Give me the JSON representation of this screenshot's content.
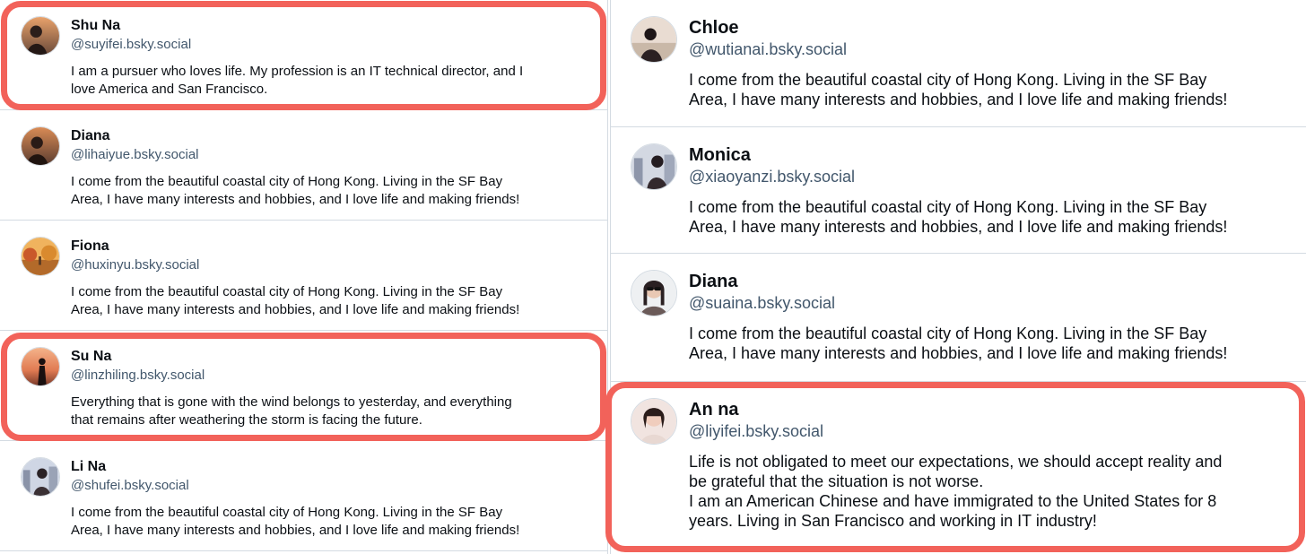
{
  "colors": {
    "highlight": "#f2625a",
    "handle": "#42576c",
    "divider": "#d4dbe2"
  },
  "left_column": [
    {
      "name": "Shu Na",
      "handle": "@suyifei.bsky.social",
      "bio": "I am a pursuer who loves life. My profession is an IT technical director, and I\nlove America and San Francisco.",
      "highlighted": true,
      "avatar": "sunset-portrait-avatar"
    },
    {
      "name": "Diana",
      "handle": "@lihaiyue.bsky.social",
      "bio": "I come from the beautiful coastal city of Hong Kong. Living in the SF Bay\nArea, I have many interests and hobbies, and I love life and making friends!",
      "highlighted": false,
      "avatar": "sunset-portrait-avatar"
    },
    {
      "name": "Fiona",
      "handle": "@huxinyu.bsky.social",
      "bio": "I come from the beautiful coastal city of Hong Kong. Living in the SF Bay\nArea, I have many interests and hobbies, and I love life and making friends!",
      "highlighted": false,
      "avatar": "autumn-landscape-avatar"
    },
    {
      "name": "Su Na",
      "handle": "@linzhiling.bsky.social",
      "bio": "Everything that is gone with the wind belongs to yesterday, and everything\nthat remains after weathering the storm is facing the future.",
      "highlighted": true,
      "avatar": "sunset-silhouette-avatar"
    },
    {
      "name": "Li Na",
      "handle": "@shufei.bsky.social",
      "bio": "I come from the beautiful coastal city of Hong Kong. Living in the SF Bay\nArea, I have many interests and hobbies, and I love life and making friends!",
      "highlighted": false,
      "avatar": "city-portrait-avatar"
    }
  ],
  "right_column": [
    {
      "name": "Chloe",
      "handle": "@wutianai.bsky.social",
      "bio": "I come from the beautiful coastal city of Hong Kong. Living in the SF Bay\nArea, I have many interests and hobbies, and I love life and making friends!",
      "highlighted": false,
      "avatar": "seaside-portrait-avatar"
    },
    {
      "name": "Monica",
      "handle": "@xiaoyanzi.bsky.social",
      "bio": "I come from the beautiful coastal city of Hong Kong. Living in the SF Bay\nArea, I have many interests and hobbies, and I love life and making friends!",
      "highlighted": false,
      "avatar": "city-portrait-avatar"
    },
    {
      "name": "Diana",
      "handle": "@suaina.bsky.social",
      "bio": "I come from the beautiful coastal city of Hong Kong. Living in the SF Bay\nArea, I have many interests and hobbies, and I love life and making friends!",
      "highlighted": false,
      "avatar": "sunglasses-portrait-avatar"
    },
    {
      "name": "An na",
      "handle": "@liyifei.bsky.social",
      "bio": "Life is not obligated to meet our expectations, we should accept reality and\nbe grateful that the situation is not worse.\nI am an American Chinese and have immigrated to the United States for 8\nyears. Living in San Francisco and working in IT industry!",
      "highlighted": true,
      "avatar": "portrait-avatar"
    }
  ]
}
